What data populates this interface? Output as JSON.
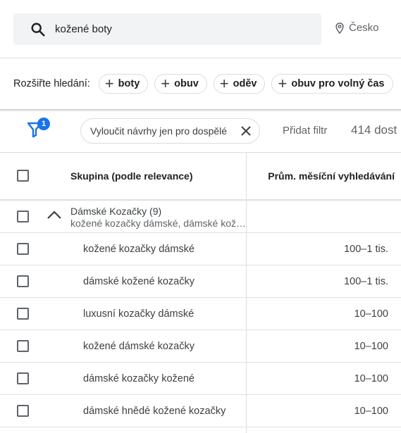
{
  "search": {
    "query": "kožené boty",
    "location": "Česko"
  },
  "expand": {
    "label": "Rozšiřte hledání:",
    "chips": [
      "boty",
      "obuv",
      "oděv",
      "obuv pro volný čas"
    ]
  },
  "filters": {
    "badge_count": "1",
    "active_filter": "Vyloučit návrhy jen pro dospělé",
    "add_filter": "Přidat filtr",
    "result_count": "414 dost"
  },
  "table": {
    "headers": {
      "group": "Skupina (podle relevance)",
      "volume": "Prům. měsíční vyhledávání"
    },
    "group": {
      "title": "Dámské Kozačky (9)",
      "subtitle": "kožené kozačky dámské, dámské kož…"
    },
    "rows": [
      {
        "keyword": "kožené kozačky dámské",
        "volume": "100–1 tis."
      },
      {
        "keyword": "dámské kožené kozačky",
        "volume": "100–1 tis."
      },
      {
        "keyword": "luxusní kozačky dámské",
        "volume": "10–100"
      },
      {
        "keyword": "kožené dámské kozačky",
        "volume": "10–100"
      },
      {
        "keyword": "dámské kozačky kožené",
        "volume": "10–100"
      },
      {
        "keyword": "dámské hnědé kožené kozačky",
        "volume": "10–100"
      }
    ]
  },
  "colors": {
    "accent": "#1a73e8",
    "border": "#dadce0",
    "search_bg": "#f1f3f4"
  }
}
